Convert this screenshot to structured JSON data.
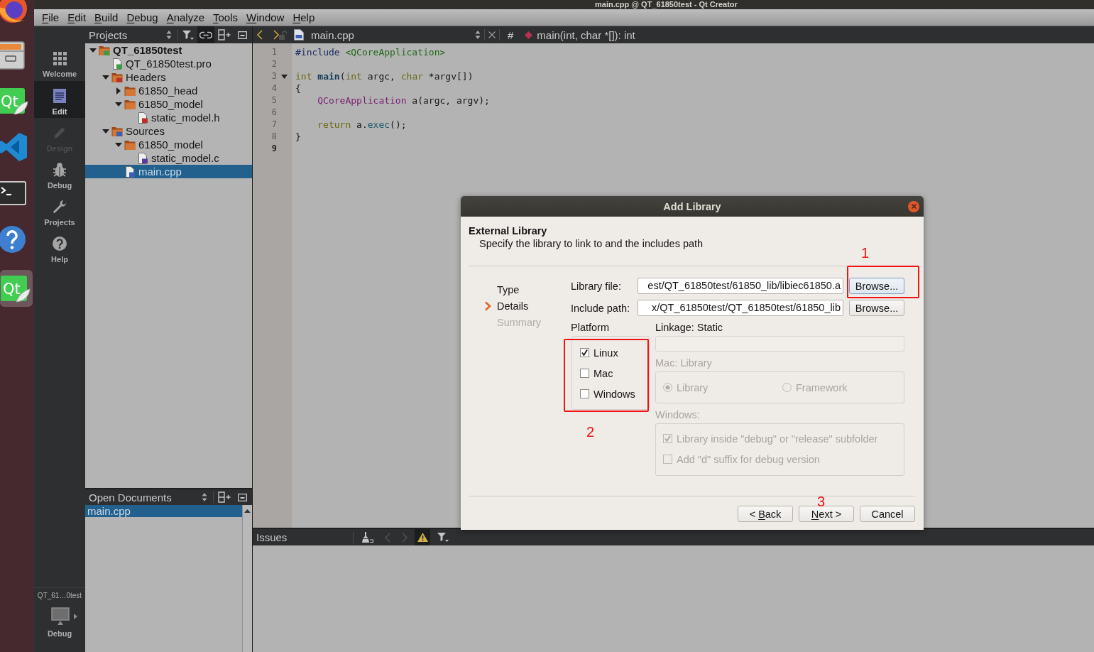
{
  "window": {
    "title": "main.cpp @ QT_61850test - Qt Creator"
  },
  "dock": [
    {
      "kind": "firefox",
      "selected": false
    },
    {
      "kind": "files",
      "selected": false
    },
    {
      "kind": "qt",
      "logo": "Qt",
      "selected": false
    },
    {
      "kind": "vscode",
      "selected": false
    },
    {
      "kind": "terminal",
      "selected": false
    },
    {
      "kind": "help",
      "selected": false
    },
    {
      "kind": "qt",
      "logo": "Qt",
      "selected": true
    }
  ],
  "menu": [
    {
      "label": "File",
      "mnemonic": true
    },
    {
      "label": "Edit",
      "mnemonic": true
    },
    {
      "label": "Build",
      "mnemonic": true
    },
    {
      "label": "Debug",
      "mnemonic": true
    },
    {
      "label": "Analyze",
      "mnemonic": true
    },
    {
      "label": "Tools",
      "mnemonic": true
    },
    {
      "label": "Window",
      "mnemonic": true
    },
    {
      "label": "Help",
      "mnemonic": true
    }
  ],
  "mode_bar": {
    "modes": [
      {
        "kind": "welcome",
        "label": "Welcome",
        "selected": false,
        "disabled": false
      },
      {
        "kind": "edit",
        "label": "Edit",
        "selected": true,
        "disabled": false
      },
      {
        "kind": "design",
        "label": "Design",
        "selected": false,
        "disabled": true
      },
      {
        "kind": "debug",
        "label": "Debug",
        "selected": false,
        "disabled": false
      },
      {
        "kind": "projects",
        "label": "Projects",
        "selected": false,
        "disabled": false
      },
      {
        "kind": "help",
        "label": "Help",
        "selected": false,
        "disabled": false
      }
    ],
    "project": "QT_61…0test",
    "build": "Debug"
  },
  "projects_pane": {
    "title": "Projects",
    "sync_on": true,
    "tree": [
      {
        "label": "QT_61850test",
        "kind": "project",
        "expanded": true,
        "selected": false,
        "children": [
          {
            "label": "QT_61850test.pro",
            "kind": "pro",
            "selected": false
          },
          {
            "label": "Headers",
            "kind": "headers",
            "expanded": true,
            "selected": false,
            "children": [
              {
                "label": "61850_head",
                "kind": "folder",
                "expanded": false,
                "selected": false
              },
              {
                "label": "61850_model",
                "kind": "folder",
                "expanded": true,
                "selected": false,
                "children": [
                  {
                    "label": "static_model.h",
                    "kind": "h",
                    "selected": false
                  }
                ]
              }
            ]
          },
          {
            "label": "Sources",
            "kind": "sources",
            "expanded": true,
            "selected": false,
            "children": [
              {
                "label": "61850_model",
                "kind": "folder",
                "expanded": true,
                "selected": false,
                "children": [
                  {
                    "label": "static_model.c",
                    "kind": "c",
                    "selected": false
                  }
                ]
              },
              {
                "label": "main.cpp",
                "kind": "cpp",
                "selected": true
              }
            ]
          }
        ]
      }
    ]
  },
  "open_documents": {
    "title": "Open Documents",
    "items": [
      {
        "label": "main.cpp",
        "selected": true
      }
    ]
  },
  "editor": {
    "file": "main.cpp",
    "hash": "#",
    "symbol": "main(int, char *[]): int",
    "lines": [
      {
        "number": "1",
        "current": false,
        "fold_marker": false,
        "indented": false,
        "tokens": [
          {
            "text": "#include",
            "kind": "preproc"
          },
          {
            "text": " <QCoreApplication>",
            "kind": "string"
          }
        ]
      },
      {
        "number": "2",
        "current": false,
        "fold_marker": false
      },
      {
        "number": "3",
        "current": false,
        "fold_marker": true,
        "indented": false,
        "tokens": [
          {
            "text": "int",
            "kind": "type"
          },
          {
            "text": " main",
            "kind": "function"
          },
          {
            "text": "(",
            "kind": "plain"
          },
          {
            "text": "int",
            "kind": "type"
          },
          {
            "text": " argc, ",
            "kind": "plain"
          },
          {
            "text": "char",
            "kind": "type"
          },
          {
            "text": " *argv[])",
            "kind": "plain"
          }
        ]
      },
      {
        "number": "4",
        "current": false,
        "fold_marker": false,
        "indented": false,
        "tokens": [
          {
            "text": "{",
            "kind": "plain"
          }
        ]
      },
      {
        "number": "5",
        "current": false,
        "fold_marker": false,
        "indented": true,
        "tokens": [
          {
            "text": "QCoreApplication",
            "kind": "class"
          },
          {
            "text": " a(argc, argv);",
            "kind": "plain"
          }
        ]
      },
      {
        "number": "6",
        "current": false,
        "fold_marker": false
      },
      {
        "number": "7",
        "current": false,
        "fold_marker": false,
        "indented": true,
        "tokens": [
          {
            "text": "return",
            "kind": "keyword"
          },
          {
            "text": " a.",
            "kind": "plain"
          },
          {
            "text": "exec",
            "kind": "method"
          },
          {
            "text": "();",
            "kind": "plain"
          }
        ]
      },
      {
        "number": "8",
        "current": false,
        "fold_marker": false,
        "indented": false,
        "tokens": [
          {
            "text": "}",
            "kind": "plain"
          }
        ]
      },
      {
        "number": "9",
        "current": true,
        "fold_marker": false
      }
    ]
  },
  "issues": {
    "title": "Issues",
    "warnings_on": true
  },
  "dialog": {
    "title": "Add Library",
    "heading": "External Library",
    "subtitle": "Specify the library to link to and the includes path",
    "steps": [
      {
        "label": "Type",
        "selected": false,
        "disabled": false
      },
      {
        "label": "Details",
        "selected": true,
        "disabled": false
      },
      {
        "label": "Summary",
        "selected": false,
        "disabled": true
      }
    ],
    "fields": [
      {
        "label": "Library file:",
        "value": "est/QT_61850test/61850_lib/libiec61850.a",
        "button": {
          "label": "Browse...",
          "focused": true,
          "annotation": {
            "label": "1",
            "boxed": true
          }
        }
      },
      {
        "label": "Include path:",
        "value": "x/QT_61850test/QT_61850test/61850_lib",
        "button": {
          "label": "Browse...",
          "focused": false
        }
      }
    ],
    "platform": {
      "label": "Platform",
      "options": [
        {
          "label": "Linux",
          "checked": true
        },
        {
          "label": "Mac",
          "checked": false
        },
        {
          "label": "Windows",
          "checked": false
        }
      ],
      "annotation": {
        "label": "2",
        "boxed": true
      }
    },
    "linkage": {
      "label": "Linkage: Static",
      "disabled": true
    },
    "mac": {
      "label": "Mac: Library",
      "disabled": true,
      "options": [
        {
          "label": "Library",
          "selected": true
        },
        {
          "label": "Framework",
          "selected": false
        }
      ]
    },
    "windows": {
      "label": "Windows:",
      "disabled": true,
      "options": [
        {
          "label": "Library inside \"debug\" or \"release\" subfolder",
          "checked": true
        },
        {
          "label": "Add \"d\" suffix for debug version",
          "checked": false
        }
      ]
    },
    "buttons": [
      {
        "label": "< Back",
        "mnemonic": true
      },
      {
        "label": "Next >",
        "mnemonic": true,
        "annotation": {
          "label": "3",
          "boxed": false
        }
      },
      {
        "label": "Cancel",
        "mnemonic": false
      }
    ]
  }
}
